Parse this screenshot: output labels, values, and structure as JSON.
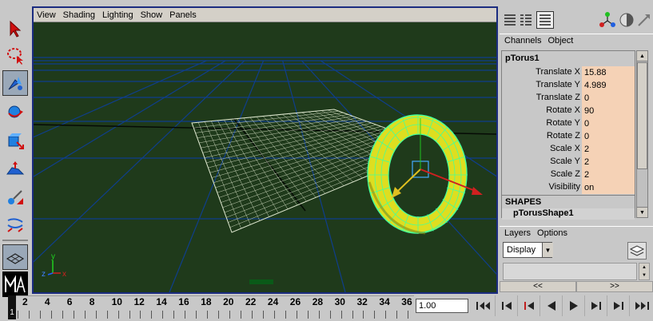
{
  "viewport": {
    "menu": [
      "View",
      "Shading",
      "Lighting",
      "Show",
      "Panels"
    ],
    "axis": {
      "x": "x",
      "y": "y",
      "z": "z"
    }
  },
  "toolbox": {
    "tools": [
      "select-tool",
      "lasso-tool",
      "paint-select-tool",
      "move-tool",
      "rotate-tool",
      "scale-tool",
      "soft-mod-tool",
      "show-manipulator-tool",
      "split-polygon-tool"
    ],
    "active": "paint-select-tool"
  },
  "channel_box": {
    "tabs": [
      "Channels",
      "Object"
    ],
    "object_name": "pTorus1",
    "channels": [
      {
        "label": "Translate X",
        "value": "15.88"
      },
      {
        "label": "Translate Y",
        "value": "4.989"
      },
      {
        "label": "Translate Z",
        "value": "0"
      },
      {
        "label": "Rotate X",
        "value": "90"
      },
      {
        "label": "Rotate Y",
        "value": "0"
      },
      {
        "label": "Rotate Z",
        "value": "0"
      },
      {
        "label": "Scale X",
        "value": "2"
      },
      {
        "label": "Scale Y",
        "value": "2"
      },
      {
        "label": "Scale Z",
        "value": "2"
      },
      {
        "label": "Visibility",
        "value": "on"
      }
    ],
    "shapes_header": "SHAPES",
    "shape_name": "pTorusShape1"
  },
  "layers": {
    "tabs": [
      "Layers",
      "Options"
    ],
    "display_value": "Display"
  },
  "page_nav": {
    "prev": "<<",
    "next": ">>"
  },
  "timeline": {
    "ticks": [
      "2",
      "4",
      "6",
      "8",
      "10",
      "12",
      "14",
      "16",
      "18",
      "20",
      "22",
      "24",
      "26",
      "28",
      "30",
      "32",
      "34",
      "36"
    ],
    "current_frame": "1",
    "current_time": "1.00"
  },
  "colors": {
    "viewport_bg": "#1f3a1b",
    "grid_line": "#0f3e8c",
    "torus_fill": "#dede20",
    "torus_wire": "#44ff9a",
    "channel_value_bg": "#f5d2b6",
    "active_border": "#1b2c80"
  }
}
